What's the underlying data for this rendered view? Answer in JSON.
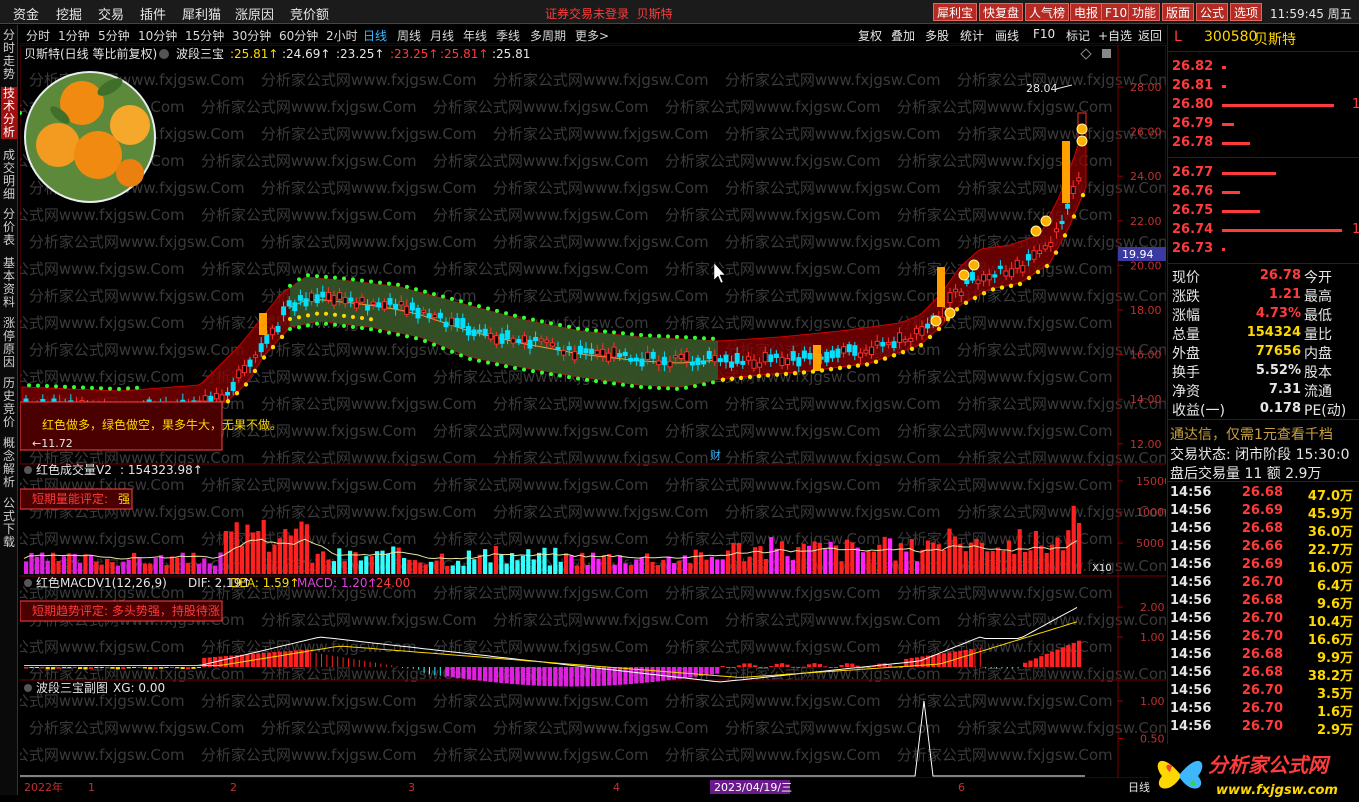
{
  "menu": {
    "items": [
      "资金",
      "挖掘",
      "交易",
      "插件",
      "犀利猫",
      "涨原因",
      "竞价额"
    ],
    "notice": "证券交易未登录",
    "notice_stock": "贝斯特",
    "right_buttons": [
      "犀利宝",
      "快复盘",
      "人气榜",
      "电报",
      "F10",
      "功能",
      "版面",
      "公式",
      "选项"
    ],
    "time": "11:59:45",
    "weekday": "周五"
  },
  "left_tabs": [
    "分时走势",
    "技术分析",
    "成交明细",
    "分价表",
    "基本资料",
    "涨停原因",
    "历史竞价",
    "概念解析",
    "公式下载"
  ],
  "period_bar": {
    "items": [
      "分时",
      "1分钟",
      "5分钟",
      "10分钟",
      "15分钟",
      "30分钟",
      "60分钟",
      "2小时",
      "日线",
      "周线",
      "月线",
      "年线",
      "季线",
      "多周期",
      "更多>"
    ],
    "active": "日线",
    "tools": [
      "复权",
      "叠加",
      "多股",
      "统计",
      "画线",
      "F10",
      "标记",
      "+自选",
      "返回"
    ]
  },
  "main_chart": {
    "title": "贝斯特(日线 等比前复权)",
    "indicator": "波段三宝",
    "v1": ":25.81↑",
    "v2": ":24.69↑",
    "v3": ":23.25↑",
    "v4": ":23.25↑",
    "v5": ":25.81↑",
    "v6": ":25.81",
    "y_ticks": [
      "28.00",
      "26.00",
      "24.00",
      "22.00",
      "20.00",
      "18.00",
      "16.00",
      "14.00",
      "12.00"
    ],
    "label_high": "28.04",
    "label_low": "11.72",
    "price_marker": "19.94",
    "info_box": "红色做多，绿色做空，果多牛大，无果不做。",
    "event_mark": "财"
  },
  "vol_panel": {
    "title": "红色成交量V2",
    "value": ": 154323.98↑",
    "eval_label": "短期量能评定:",
    "eval_value": "强",
    "y_ticks": [
      "15000",
      "10000",
      "5000"
    ],
    "unit": "X10"
  },
  "macd_panel": {
    "title": "红色MACDV1(12,26,9)",
    "dif": "DIF: 2.19↑",
    "dea": "DEA: 1.59↑",
    "macd": "MACD: 1.20↑",
    "extra": ": 24.00",
    "eval": "短期趋势评定: 多头势强，持股待涨",
    "y_ticks": [
      "2.00",
      "1.00"
    ]
  },
  "sub_panel": {
    "title": "波段三宝副图",
    "xg": "XG: 0.00",
    "y_ticks": [
      "1.00",
      "0.50"
    ]
  },
  "x_axis": {
    "labels": [
      "2022年",
      "1",
      "2",
      "3",
      "4",
      "6"
    ],
    "cursor_date": "2023/04/19/三",
    "right_label": "日线"
  },
  "right_panel": {
    "market": "L",
    "code": "300580",
    "name": "贝斯特",
    "asks": [
      {
        "p": "26.82"
      },
      {
        "p": "26.81"
      },
      {
        "p": "26.80",
        "q": "1"
      },
      {
        "p": "26.79"
      },
      {
        "p": "26.78"
      }
    ],
    "bids": [
      {
        "p": "26.77"
      },
      {
        "p": "26.76"
      },
      {
        "p": "26.75"
      },
      {
        "p": "26.74",
        "q": "1"
      },
      {
        "p": "26.73"
      }
    ],
    "stats": [
      {
        "l": "现价",
        "v": "26.78",
        "r": "今开"
      },
      {
        "l": "涨跌",
        "v": "1.21",
        "r": "最高"
      },
      {
        "l": "涨幅",
        "v": "4.73%",
        "r": "最低"
      },
      {
        "l": "总量",
        "v": "154324",
        "r": "量比"
      },
      {
        "l": "外盘",
        "v": "77656",
        "r": "内盘"
      },
      {
        "l": "换手",
        "v": "5.52%",
        "r": "股本"
      },
      {
        "l": "净资",
        "v": "7.31",
        "r": "流通"
      },
      {
        "l": "收益(一)",
        "v": "0.178",
        "r": "PE(动)"
      }
    ],
    "promo": "通达信，仅需1元查看千档",
    "trade_state": "交易状态: 闭市阶段 15:30:0",
    "after_hours": "盘后交易量 11 额 2.9万",
    "ticks": [
      [
        "14:56",
        "26.68",
        "47.0万"
      ],
      [
        "14:56",
        "26.69",
        "45.9万"
      ],
      [
        "14:56",
        "26.68",
        "36.0万"
      ],
      [
        "14:56",
        "26.66",
        "22.7万"
      ],
      [
        "14:56",
        "26.69",
        "16.0万"
      ],
      [
        "14:56",
        "26.70",
        "6.4万"
      ],
      [
        "14:56",
        "26.68",
        "9.6万"
      ],
      [
        "14:56",
        "26.70",
        "10.4万"
      ],
      [
        "14:56",
        "26.70",
        "16.6万"
      ],
      [
        "14:56",
        "26.68",
        "9.9万"
      ],
      [
        "14:56",
        "26.68",
        "38.2万"
      ],
      [
        "14:56",
        "26.70",
        "3.5万"
      ],
      [
        "14:56",
        "26.70",
        "1.6万"
      ],
      [
        "14:56",
        "26.70",
        "2.9万"
      ]
    ]
  },
  "watermark": "分析家公式网www.fxjgsw.Com",
  "logo_text": "分析家公式网",
  "logo_url": "www.fxjgsw.com"
}
